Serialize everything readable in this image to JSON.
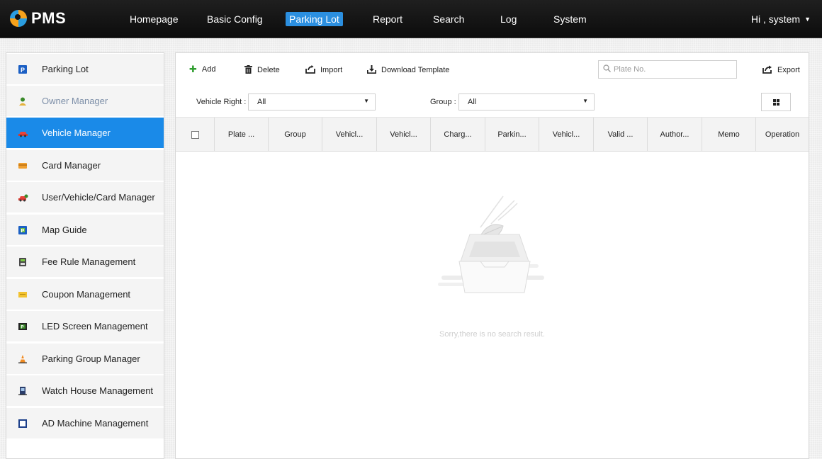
{
  "app": {
    "logo_text": "PMS",
    "brand_colors": [
      "#f7a21b",
      "#2a9de0"
    ]
  },
  "nav": {
    "items": [
      {
        "label": "Homepage",
        "active": false
      },
      {
        "label": "Basic Config",
        "active": false
      },
      {
        "label": "Parking Lot",
        "active": true
      },
      {
        "label": "Report",
        "active": false
      },
      {
        "label": "Search",
        "active": false
      },
      {
        "label": "Log",
        "active": false
      },
      {
        "label": "System",
        "active": false
      }
    ],
    "user_greeting": "Hi , system",
    "user_caret": "▼",
    "active_color": "#2b8fe0"
  },
  "sidebar": {
    "items": [
      {
        "label": "Parking Lot",
        "icon": "parking-icon"
      },
      {
        "label": "Owner Manager",
        "icon": "owner-icon"
      },
      {
        "label": "Vehicle Manager",
        "icon": "car-icon",
        "active": true
      },
      {
        "label": "Card Manager",
        "icon": "card-icon"
      },
      {
        "label": "User/Vehicle/Card Manager",
        "icon": "user-vehicle-card-icon"
      },
      {
        "label": "Map Guide",
        "icon": "map-guide-icon"
      },
      {
        "label": "Fee Rule Management",
        "icon": "fee-rule-icon"
      },
      {
        "label": "Coupon Management",
        "icon": "coupon-icon"
      },
      {
        "label": "LED Screen Management",
        "icon": "led-screen-icon"
      },
      {
        "label": "Parking Group Manager",
        "icon": "parking-group-icon"
      },
      {
        "label": "Watch House Management",
        "icon": "watch-house-icon"
      },
      {
        "label": "AD Machine Management",
        "icon": "ad-machine-icon"
      }
    ],
    "active_color": "#1a8ae8"
  },
  "toolbar": {
    "add_label": "Add",
    "delete_label": "Delete",
    "import_label": "Import",
    "download_template_label": "Download Template",
    "export_label": "Export"
  },
  "search": {
    "placeholder": "Plate No.",
    "value": ""
  },
  "filters": {
    "vehicle_right_label": "Vehicle Right :",
    "vehicle_right_value": "All",
    "group_label": "Group :",
    "group_value": "All"
  },
  "table": {
    "columns": [
      "Plate ...",
      "Group",
      "Vehicl...",
      "Vehicl...",
      "Charg...",
      "Parkin...",
      "Vehicl...",
      "Valid ...",
      "Author...",
      "Memo",
      "Operation"
    ],
    "rows": []
  },
  "empty_state": {
    "message": "Sorry,there is no search result."
  }
}
